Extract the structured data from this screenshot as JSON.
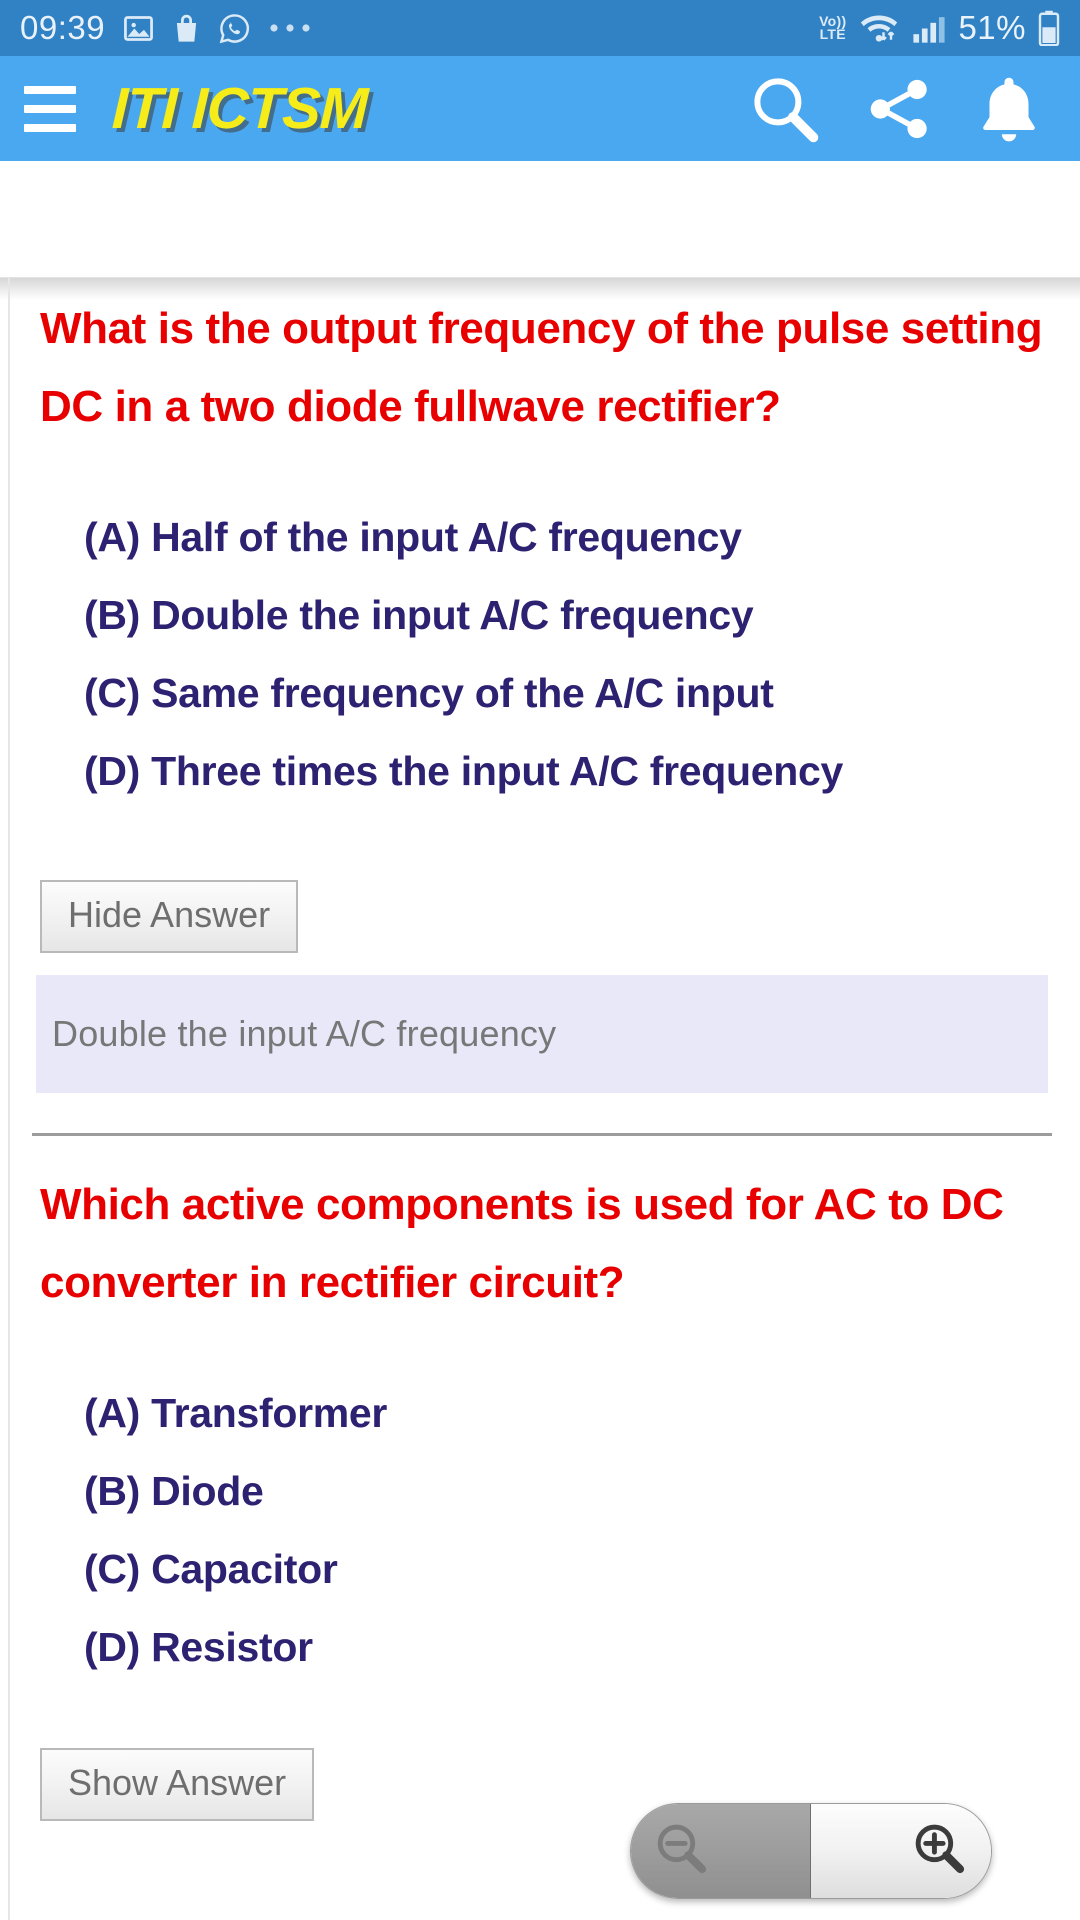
{
  "status_bar": {
    "clock": "09:39",
    "left_icons": [
      "image-icon",
      "shopping-bag-icon",
      "whatsapp-icon",
      "overflow-dots-icon"
    ],
    "network_label_top": "Vo))",
    "network_label_bottom": "LTE",
    "right_icons": [
      "wifi-icon",
      "cellular-signal-icon",
      "battery-icon"
    ],
    "battery_percent": "51%"
  },
  "app_bar": {
    "menu_icon": "hamburger-menu-icon",
    "title": "ITI ICTSM",
    "actions": [
      "search-icon",
      "share-icon",
      "notification-bell-icon"
    ],
    "background_color": "#4aa8f0",
    "title_color": "#f5ec19"
  },
  "colors": {
    "question_red": "#e80000",
    "option_navy": "#2d2171",
    "answer_box_bg": "#e8e8f9",
    "answer_text_gray": "#777777",
    "status_bar_blue": "#3182c4"
  },
  "quiz": {
    "questions": [
      {
        "text_line1": "What is the output frequency of the pulse setting",
        "text_line2": "DC in a two diode fullwave rectifier?",
        "options": [
          "(A) Half of the input A/C frequency",
          "(B) Double the input A/C frequency",
          "(C) Same frequency of the A/C input",
          "(D) Three times the input A/C frequency"
        ],
        "toggle_label": "Hide Answer",
        "answer_visible": true,
        "answer": "Double the input A/C frequency"
      },
      {
        "text_line1": "Which active components is used for AC to DC",
        "text_line2": "converter in rectifier circuit?",
        "options": [
          "(A) Transformer",
          "(B) Diode",
          "(C) Capacitor",
          "(D) Resistor"
        ],
        "toggle_label": "Show Answer",
        "answer_visible": false,
        "answer": ""
      }
    ]
  },
  "zoom_control": {
    "zoom_out_icon": "zoom-out-magnifier-icon",
    "zoom_in_icon": "zoom-in-magnifier-icon",
    "zoom_out_enabled": false,
    "zoom_in_enabled": true
  }
}
